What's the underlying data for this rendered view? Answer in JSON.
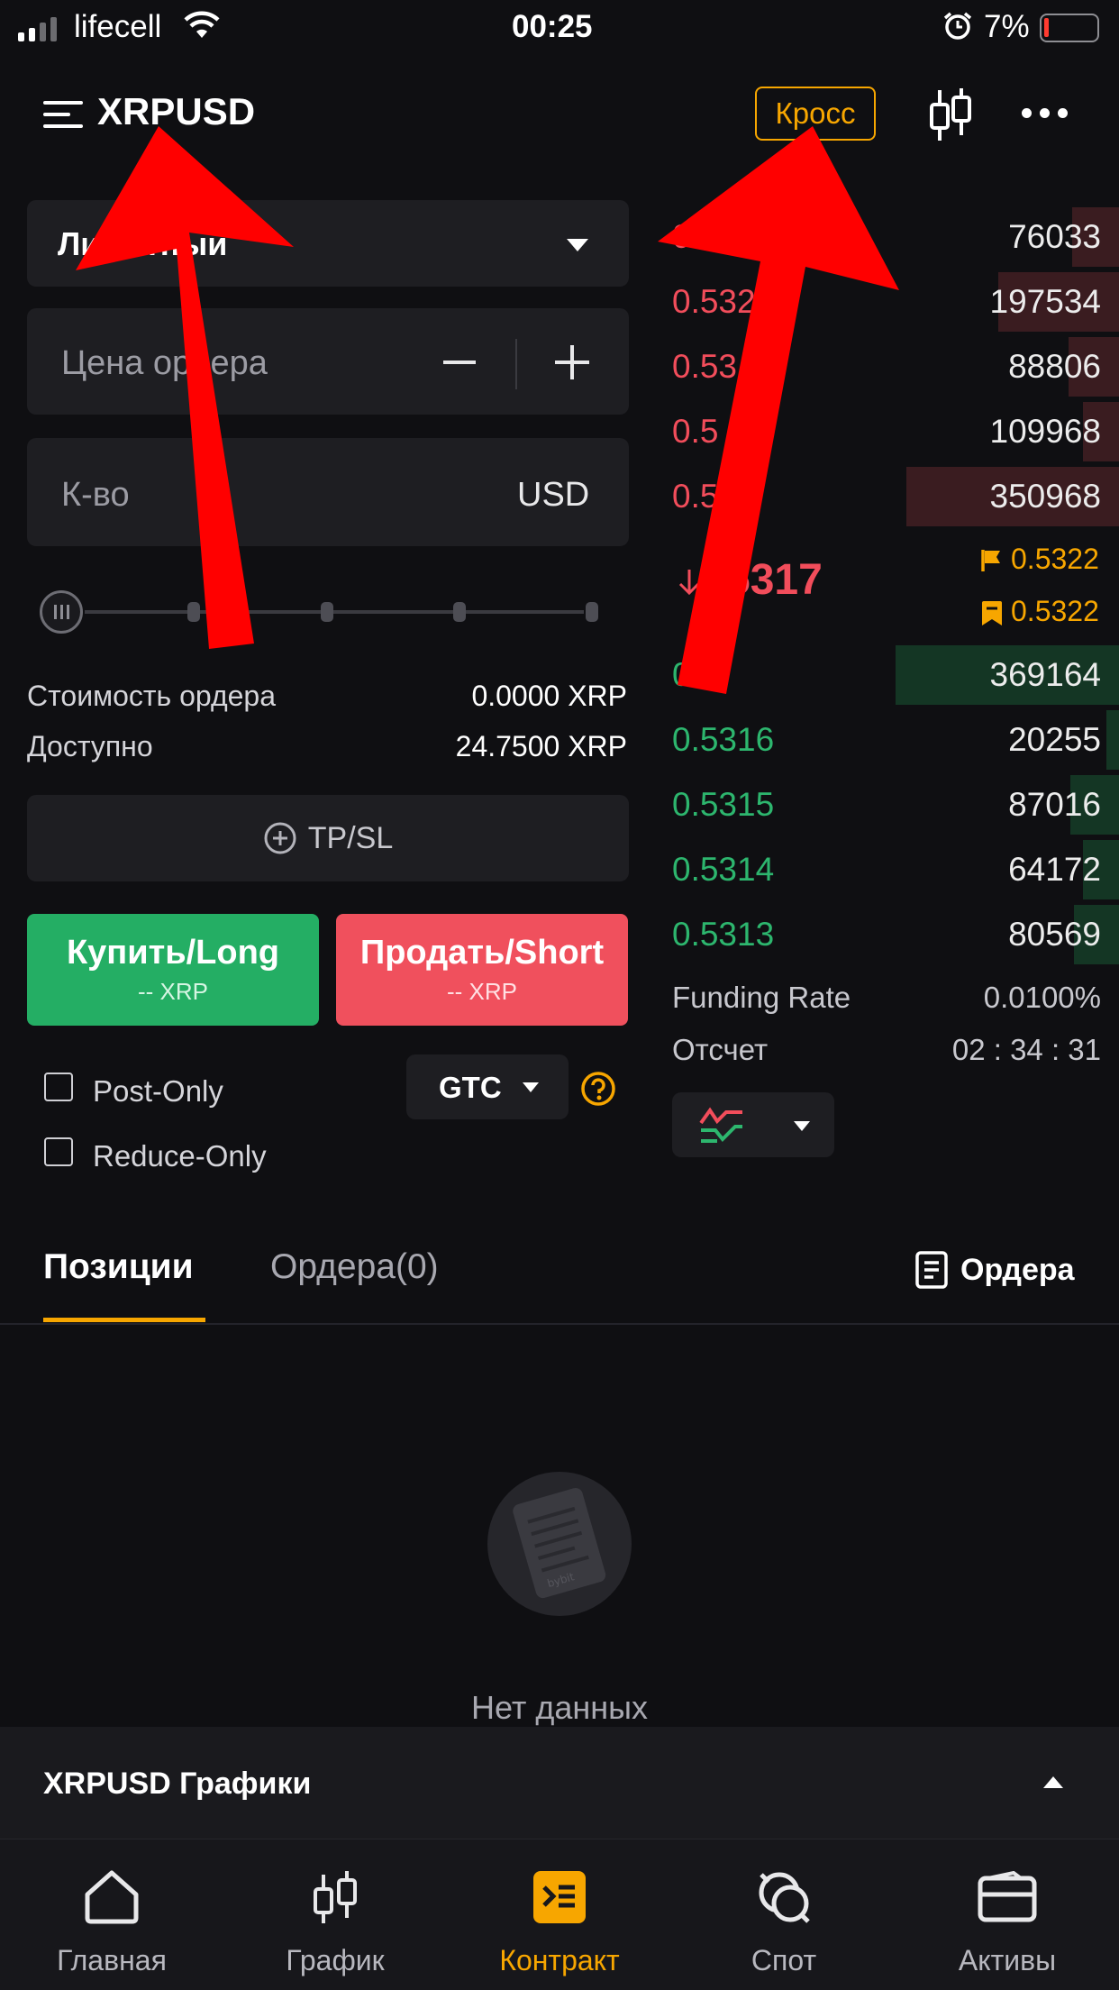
{
  "status_bar": {
    "carrier": "lifecell",
    "time": "00:25",
    "battery": "7%"
  },
  "header": {
    "symbol": "XRPUSD",
    "margin_mode": "Кросс"
  },
  "order_form": {
    "order_type": "Лимитный",
    "price_placeholder": "Цена ордера",
    "qty_placeholder": "К-во",
    "qty_unit": "USD",
    "order_value_label": "Стоимость ордера",
    "order_value": "0.0000 XRP",
    "available_label": "Доступно",
    "available": "24.7500 XRP",
    "tpsl_label": "TP/SL",
    "buy_label": "Купить/Long",
    "buy_sub": "-- XRP",
    "sell_label": "Продать/Short",
    "sell_sub": "-- XRP",
    "post_only": "Post-Only",
    "reduce_only": "Reduce-Only",
    "tif": "GTC"
  },
  "orderbook": {
    "asks": [
      {
        "price": "0.",
        "qty": "76033",
        "depth": 0.08
      },
      {
        "price": "0.532",
        "qty": "197534",
        "depth": 0.19
      },
      {
        "price": "0.53",
        "qty": "88806",
        "depth": 0.09
      },
      {
        "price": "0.5",
        "qty": "109968",
        "depth": 0.11
      },
      {
        "price": "0.5  8",
        "qty": "350968",
        "depth": 0.34
      }
    ],
    "last_price": "5317",
    "mark_price": "0.5322",
    "index_price": "0.5322",
    "bids": [
      {
        "price": "0.",
        "qty": "369164",
        "depth": 0.36
      },
      {
        "price": "0.5316",
        "qty": "20255",
        "depth": 0.02
      },
      {
        "price": "0.5315",
        "qty": "87016",
        "depth": 0.08
      },
      {
        "price": "0.5314",
        "qty": "64172",
        "depth": 0.06
      },
      {
        "price": "0.5313",
        "qty": "80569",
        "depth": 0.08
      }
    ],
    "funding_label": "Funding Rate",
    "funding_value": "0.0100%",
    "countdown_label": "Отсчет",
    "countdown_value": "02 : 34 : 31"
  },
  "positions": {
    "tab_positions": "Позиции",
    "tab_orders": "Ордера(0)",
    "orders_link": "Ордера",
    "empty_text": "Нет данных"
  },
  "charts_bar": {
    "label": "XRPUSD Графики"
  },
  "bottom_nav": [
    {
      "label": "Главная",
      "icon": "home-icon"
    },
    {
      "label": "График",
      "icon": "candlestick-icon"
    },
    {
      "label": "Контракт",
      "icon": "contract-icon",
      "active": true
    },
    {
      "label": "Спот",
      "icon": "spot-icon"
    },
    {
      "label": "Активы",
      "icon": "wallet-icon"
    }
  ],
  "colors": {
    "accent": "#f7a600",
    "buy": "#2db66e",
    "sell": "#f24d5b",
    "background": "#0f0f12"
  },
  "overlay": {
    "annotation_arrows": 2
  }
}
